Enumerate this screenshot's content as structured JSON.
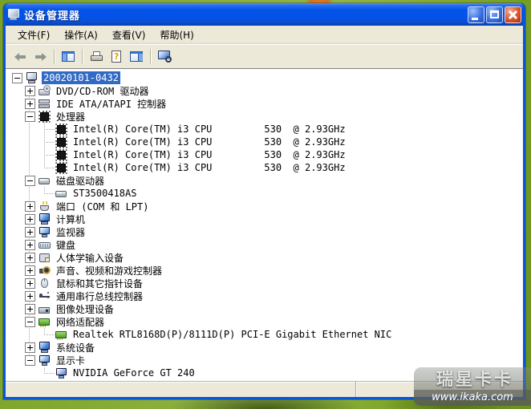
{
  "window": {
    "title": "设备管理器"
  },
  "menu_bar": {
    "items": [
      {
        "name": "file",
        "label": "文件(F)"
      },
      {
        "name": "action",
        "label": "操作(A)"
      },
      {
        "name": "view",
        "label": "查看(V)"
      },
      {
        "name": "help",
        "label": "帮助(H)"
      }
    ]
  },
  "toolbar": {
    "buttons": [
      {
        "name": "back",
        "sep_before": false,
        "disabled": true
      },
      {
        "name": "forward",
        "sep_before": false,
        "disabled": true
      },
      {
        "name": "show-console-tree",
        "sep_before": true,
        "disabled": false
      },
      {
        "name": "print",
        "sep_before": true,
        "disabled": false
      },
      {
        "name": "help-document",
        "sep_before": false,
        "disabled": false
      },
      {
        "name": "show-pane",
        "sep_before": false,
        "disabled": false
      },
      {
        "name": "scan-hardware",
        "sep_before": true,
        "disabled": false
      }
    ]
  },
  "tree": {
    "items": [
      {
        "label": "20020101-0432",
        "depth": 0,
        "expander": "minus",
        "icon": "computer",
        "selected": true,
        "connectors": ""
      },
      {
        "label": "DVD/CD-ROM 驱动器",
        "depth": 1,
        "expander": "plus",
        "icon": "cd-drive",
        "selected": false,
        "connectors": "sp1"
      },
      {
        "label": "IDE ATA/ATAPI 控制器",
        "depth": 1,
        "expander": "plus",
        "icon": "ide-controller",
        "selected": false,
        "connectors": "sp1"
      },
      {
        "label": "处理器",
        "depth": 1,
        "expander": "minus",
        "icon": "cpu",
        "selected": false,
        "connectors": "sp1"
      },
      {
        "label": "Intel(R) Core(TM) i3 CPU         530  @ 2.93GHz",
        "depth": 2,
        "expander": "none",
        "icon": "cpu",
        "selected": false,
        "connectors": "sp1 sp2f"
      },
      {
        "label": "Intel(R) Core(TM) i3 CPU         530  @ 2.93GHz",
        "depth": 2,
        "expander": "none",
        "icon": "cpu",
        "selected": false,
        "connectors": "sp1 sp2f"
      },
      {
        "label": "Intel(R) Core(TM) i3 CPU         530  @ 2.93GHz",
        "depth": 2,
        "expander": "none",
        "icon": "cpu",
        "selected": false,
        "connectors": "sp1 sp2f"
      },
      {
        "label": "Intel(R) Core(TM) i3 CPU         530  @ 2.93GHz",
        "depth": 2,
        "expander": "none",
        "icon": "cpu",
        "selected": false,
        "connectors": "sp1 sp2h"
      },
      {
        "label": "磁盘驱动器",
        "depth": 1,
        "expander": "minus",
        "icon": "disk-drive",
        "selected": false,
        "connectors": "sp1"
      },
      {
        "label": "ST3500418AS",
        "depth": 2,
        "expander": "none",
        "icon": "disk-drive",
        "selected": false,
        "connectors": "sp1 sp2h"
      },
      {
        "label": "端口 (COM 和 LPT)",
        "depth": 1,
        "expander": "plus",
        "icon": "serial-port",
        "selected": false,
        "connectors": "sp1"
      },
      {
        "label": "计算机",
        "depth": 1,
        "expander": "plus",
        "icon": "computer-system",
        "selected": false,
        "connectors": "sp1"
      },
      {
        "label": "监视器",
        "depth": 1,
        "expander": "plus",
        "icon": "monitor",
        "selected": false,
        "connectors": "sp1"
      },
      {
        "label": "键盘",
        "depth": 1,
        "expander": "plus",
        "icon": "keyboard",
        "selected": false,
        "connectors": "sp1"
      },
      {
        "label": "人体学输入设备",
        "depth": 1,
        "expander": "plus",
        "icon": "hid-device",
        "selected": false,
        "connectors": "sp1"
      },
      {
        "label": "声音、视频和游戏控制器",
        "depth": 1,
        "expander": "plus",
        "icon": "sound",
        "selected": false,
        "connectors": "sp1"
      },
      {
        "label": "鼠标和其它指针设备",
        "depth": 1,
        "expander": "plus",
        "icon": "mouse",
        "selected": false,
        "connectors": "sp1"
      },
      {
        "label": "通用串行总线控制器",
        "depth": 1,
        "expander": "plus",
        "icon": "usb",
        "selected": false,
        "connectors": "sp1"
      },
      {
        "label": "图像处理设备",
        "depth": 1,
        "expander": "plus",
        "icon": "imaging-device",
        "selected": false,
        "connectors": "sp1"
      },
      {
        "label": "网络适配器",
        "depth": 1,
        "expander": "minus",
        "icon": "network-adapter",
        "selected": false,
        "connectors": "sp1"
      },
      {
        "label": "Realtek RTL8168D(P)/8111D(P) PCI-E Gigabit Ethernet NIC",
        "depth": 2,
        "expander": "none",
        "icon": "network-adapter",
        "selected": false,
        "connectors": "sp1 sp2h"
      },
      {
        "label": "系统设备",
        "depth": 1,
        "expander": "plus",
        "icon": "system-device",
        "selected": false,
        "connectors": "sp1"
      },
      {
        "label": "显示卡",
        "depth": 1,
        "expander": "minus",
        "icon": "display-adapter",
        "selected": false,
        "connectors": "sp1h"
      },
      {
        "label": "NVIDIA GeForce GT 240",
        "depth": 2,
        "expander": "none",
        "icon": "display-adapter",
        "selected": false,
        "connectors": "sp2h"
      }
    ]
  },
  "status_bar": {
    "left_text": "",
    "right_text": ""
  },
  "watermark": {
    "brand": "瑞星卡卡",
    "site": "www.ikaka.com"
  },
  "colors": {
    "titlebar_blue": "#0353e8",
    "window_border": "#0855dd",
    "chrome_beige": "#ece9d8",
    "selection_blue": "#316ac5",
    "desktop_green": "#85ab36",
    "network_card_green": "#47a024"
  }
}
